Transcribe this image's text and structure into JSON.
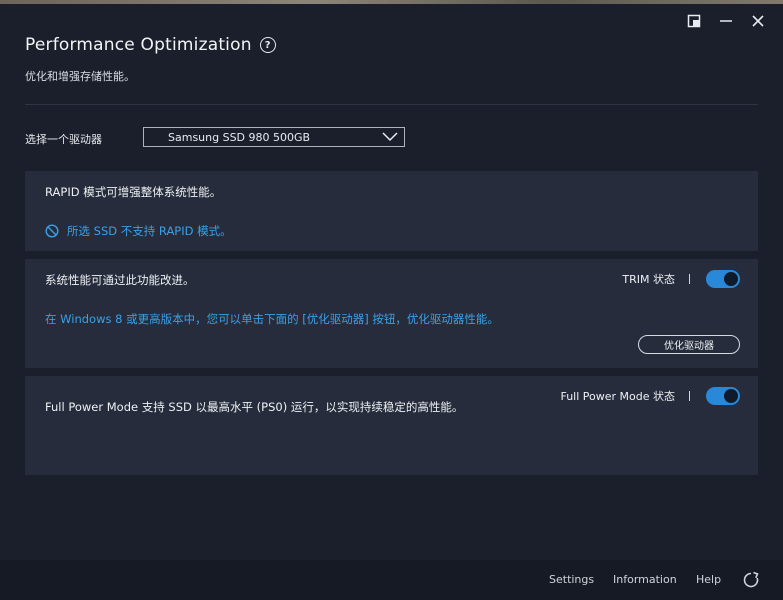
{
  "window": {
    "title": "Performance Optimization",
    "help_glyph": "?",
    "subtitle": "优化和增强存储性能。"
  },
  "drive": {
    "label": "选择一个驱动器",
    "selected": "Samsung SSD 980 500GB"
  },
  "rapid_panel": {
    "heading": "RAPID 模式可增强整体系统性能。",
    "warning": "所选 SSD 不支持 RAPID 模式。",
    "warning_icon": "prohibited-icon"
  },
  "trim_panel": {
    "heading": "系统性能可通过此功能改进。",
    "toggle_label": "TRIM 状态",
    "toggle_on": true,
    "info": "在 Windows 8 或更高版本中，您可以单击下面的 [优化驱动器] 按钮，优化驱动器性能。",
    "button_label": "优化驱动器"
  },
  "fpm_panel": {
    "heading": "Full Power Mode 支持 SSD 以最高水平 (PS0) 运行，以实现持续稳定的高性能。",
    "toggle_label": "Full Power Mode 状态",
    "toggle_on": true
  },
  "footer": {
    "settings": "Settings",
    "information": "Information",
    "help": "Help",
    "refresh_icon": "refresh-icon"
  },
  "colors": {
    "background": "#1b1f2b",
    "panel": "#262c3b",
    "accent": "#2a88d8",
    "link": "#3aa0e8",
    "footer": "#161a24"
  }
}
